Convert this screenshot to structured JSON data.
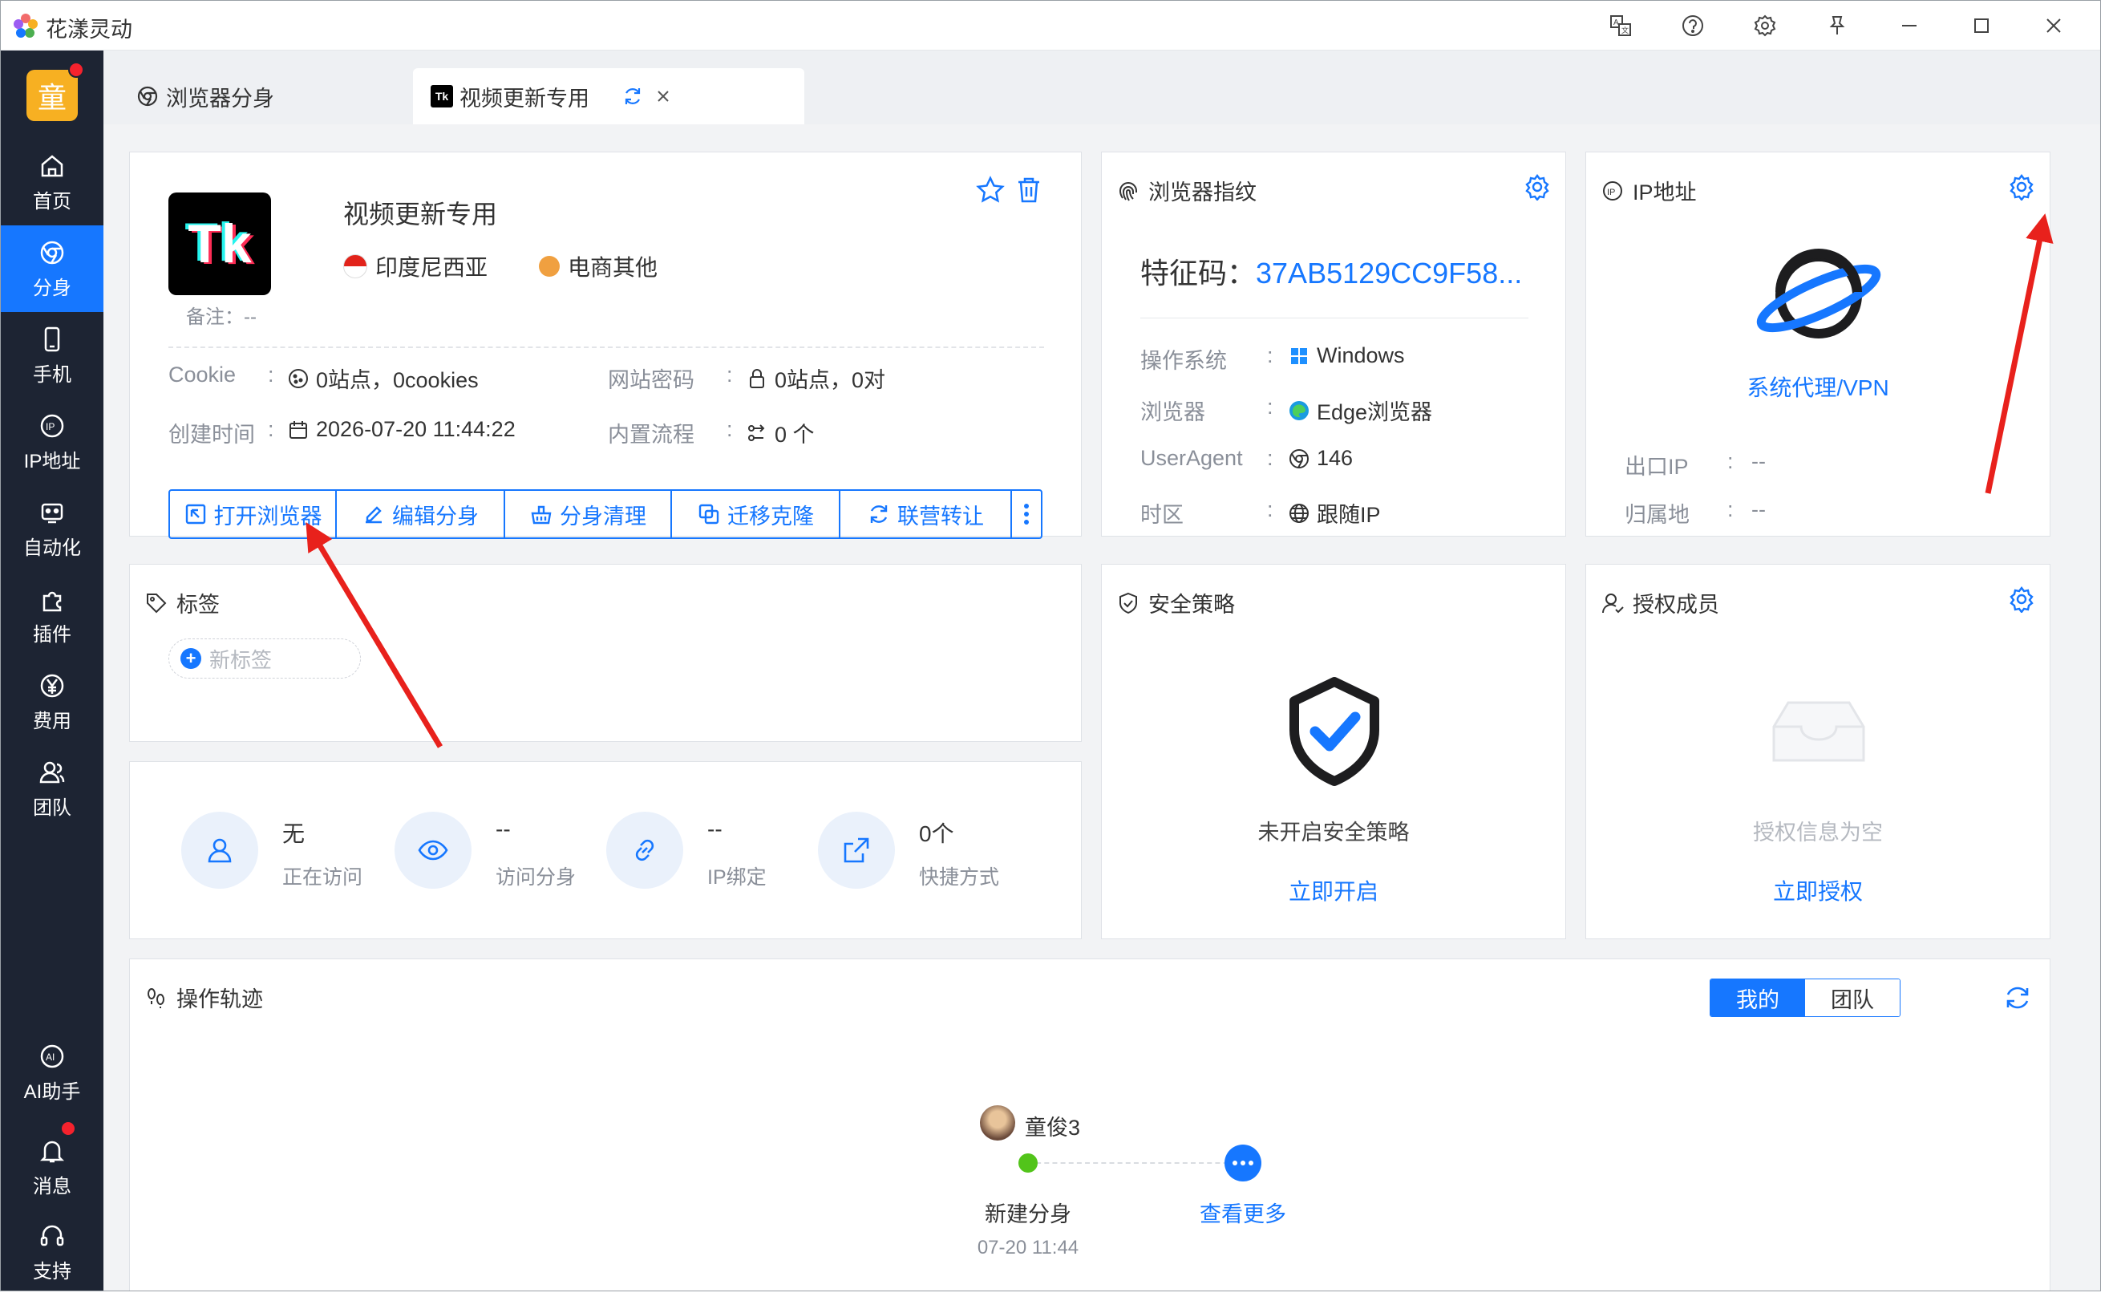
{
  "app": {
    "title": "花漾灵动"
  },
  "window_controls": [
    "translate-icon",
    "help-icon",
    "settings-icon",
    "pin-icon",
    "minimize-icon",
    "maximize-icon",
    "close-icon"
  ],
  "sidebar": {
    "avatar_text": "童",
    "items": [
      {
        "label": "首页",
        "icon": "home-icon"
      },
      {
        "label": "分身",
        "icon": "browser-profile-icon",
        "active": true
      },
      {
        "label": "手机",
        "icon": "phone-icon"
      },
      {
        "label": "IP地址",
        "icon": "ip-icon"
      },
      {
        "label": "自动化",
        "icon": "robot-icon"
      },
      {
        "label": "插件",
        "icon": "plugin-icon"
      },
      {
        "label": "费用",
        "icon": "yen-icon"
      },
      {
        "label": "团队",
        "icon": "team-icon"
      }
    ],
    "bottom_items": [
      {
        "label": "AI助手",
        "icon": "ai-icon"
      },
      {
        "label": "消息",
        "icon": "bell-icon"
      },
      {
        "label": "支持",
        "icon": "headset-icon"
      }
    ]
  },
  "tabs": [
    {
      "label": "浏览器分身",
      "icon": "browser-icon"
    },
    {
      "label": "视频更新专用",
      "icon": "tiktok-icon",
      "active": true
    }
  ],
  "profile": {
    "logo_text": "Tk",
    "name": "视频更新专用",
    "country": "印度尼西亚",
    "category": "电商其他",
    "remark_label": "备注",
    "remark_value": "--",
    "cookie_label": "Cookie",
    "cookie_value": "0站点，0cookies",
    "password_label": "网站密码",
    "password_value": "0站点，0对",
    "created_label": "创建时间",
    "created_value": "2026-07-20 11:44:22",
    "flow_label": "内置流程",
    "flow_value": "0 个",
    "actions": [
      "打开浏览器",
      "编辑分身",
      "分身清理",
      "迁移克隆",
      "联营转让"
    ]
  },
  "fingerprint": {
    "title": "浏览器指纹",
    "code_label": "特征码：",
    "code_value": "37AB5129CC9F58...",
    "rows": [
      {
        "label": "操作系统",
        "value": "Windows",
        "icon": "windows-icon"
      },
      {
        "label": "浏览器",
        "value": "Edge浏览器",
        "icon": "edge-icon"
      },
      {
        "label": "UserAgent",
        "value": "146",
        "icon": "chrome-icon"
      },
      {
        "label": "时区",
        "value": "跟随IP",
        "icon": "globe-icon"
      }
    ]
  },
  "ip": {
    "title": "IP地址",
    "proxy_label": "系统代理/VPN",
    "exit_ip_label": "出口IP",
    "exit_ip_value": "--",
    "location_label": "归属地",
    "location_value": "--"
  },
  "tags": {
    "title": "标签",
    "new_tag": "新标签"
  },
  "stats": [
    {
      "value": "无",
      "label": "正在访问",
      "icon": "user-icon"
    },
    {
      "value": "--",
      "label": "访问分身",
      "icon": "eye-icon"
    },
    {
      "value": "--",
      "label": "IP绑定",
      "icon": "link-icon"
    },
    {
      "value": "0个",
      "label": "快捷方式",
      "icon": "share-icon"
    }
  ],
  "security": {
    "title": "安全策略",
    "status": "未开启安全策略",
    "action": "立即开启"
  },
  "members": {
    "title": "授权成员",
    "empty": "授权信息为空",
    "action": "立即授权"
  },
  "trace": {
    "title": "操作轨迹",
    "segments": [
      "我的",
      "团队"
    ],
    "user": "童俊3",
    "event": "新建分身",
    "event_time": "07-20 11:44",
    "more": "查看更多"
  },
  "colors": {
    "accent": "#1677ff",
    "sidebar": "#1d2433",
    "annotation": "#e8211c"
  }
}
